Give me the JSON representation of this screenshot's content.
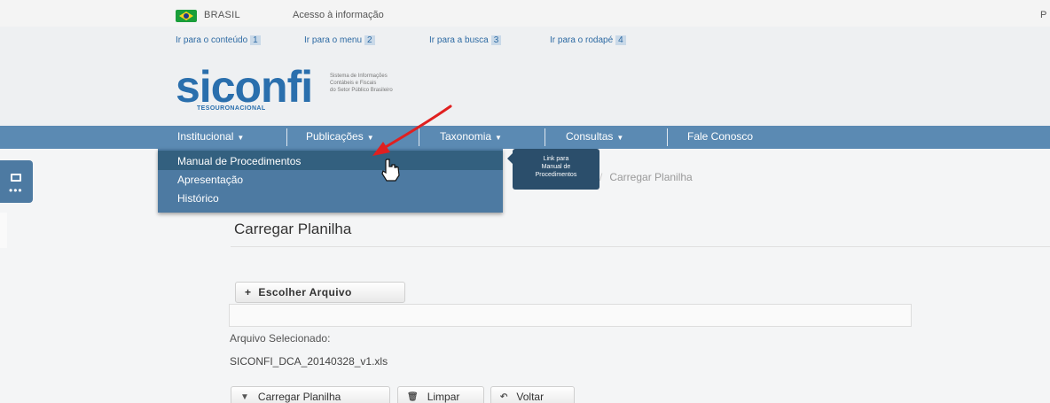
{
  "gov_bar": {
    "brasil": "BRASIL",
    "acesso": "Acesso à informação",
    "right_text": "P"
  },
  "skip_links": [
    {
      "label": "Ir para o conteúdo",
      "num": "1"
    },
    {
      "label": "Ir para o menu",
      "num": "2"
    },
    {
      "label": "Ir para a busca",
      "num": "3"
    },
    {
      "label": "Ir para o rodapé",
      "num": "4"
    }
  ],
  "logo": {
    "name": "siconfi",
    "subtitle_1": "Sistema de Informações",
    "subtitle_2": "Contábeis e Fiscais",
    "subtitle_3": "do Setor Público Brasileiro",
    "tesouro": "TESOURONACIONAL"
  },
  "nav": {
    "items": [
      {
        "label": "Institucional",
        "has_caret": true
      },
      {
        "label": "Publicações",
        "has_caret": true
      },
      {
        "label": "Taxonomia",
        "has_caret": true
      },
      {
        "label": "Consultas",
        "has_caret": true
      },
      {
        "label": "Fale Conosco",
        "has_caret": false
      }
    ],
    "caret": "▼"
  },
  "dropdown": {
    "items": [
      "Manual de Procedimentos",
      "Apresentação",
      "Histórico"
    ]
  },
  "tooltip": {
    "line1": "Link para",
    "line2": "Manual de",
    "line3": "Procedimentos"
  },
  "breadcrumb": {
    "sep": "/",
    "current": "Carregar Planilha"
  },
  "main": {
    "title": "Carregar Planilha",
    "choose_button": "Escolher Arquivo",
    "choose_icon": "+",
    "selected_label": "Arquivo Selecionado:",
    "file_name": "SICONFI_DCA_20140328_v1.xls",
    "load_button": "Carregar Planilha",
    "load_icon": "▼",
    "clear_button": "Limpar",
    "clear_icon": "🗑",
    "back_button": "Voltar",
    "back_icon": "↶"
  },
  "colors": {
    "navbar": "#5b8ab3",
    "dropdown": "#4d7aa2",
    "logo": "#2a6fad",
    "annotation_arrow": "#e02020"
  }
}
